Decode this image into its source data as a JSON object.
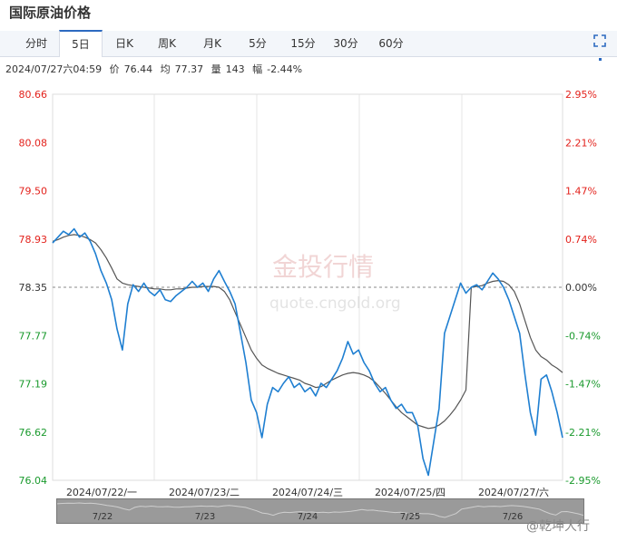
{
  "title": "国际原油价格",
  "tabs": [
    "分时",
    "5日",
    "日K",
    "周K",
    "月K",
    "5分",
    "15分",
    "30分",
    "60分"
  ],
  "active_tab": "5日",
  "info": {
    "time": "2024/07/27六04:59",
    "price_label": "价",
    "price": "76.44",
    "avg_label": "均",
    "avg": "77.37",
    "vol_label": "量",
    "vol": "143",
    "chg_label": "幅",
    "chg": "-2.44%"
  },
  "watermark": {
    "brand": "金投行情",
    "url": "quote.cngold.org"
  },
  "footer_mark": "@乾坤大行",
  "navigator_labels": [
    "7/22",
    "7/23",
    "7/24",
    "7/25",
    "7/26"
  ],
  "colors": {
    "price_line": "#1f7fd1",
    "avg_line": "#555555",
    "up": "#e3221c",
    "down": "#1a9a2d",
    "ref": "#888888"
  },
  "chart_data": {
    "type": "line",
    "ref_price": 78.35,
    "ylim": [
      76.04,
      80.66
    ],
    "y_ticks_left": [
      "80.66",
      "80.08",
      "79.50",
      "78.93",
      "78.35",
      "77.77",
      "77.19",
      "76.62",
      "76.04"
    ],
    "y_ticks_right": [
      "2.95%",
      "2.21%",
      "1.47%",
      "0.74%",
      "0.00%",
      "-0.74%",
      "-1.47%",
      "-2.21%",
      "-2.95%"
    ],
    "x_labels": [
      "2024/07/22/一",
      "2024/07/23/二",
      "2024/07/24/三",
      "2024/07/25/四",
      "2024/07/27/六"
    ],
    "series": [
      {
        "values": [
          78.88,
          78.95,
          79.02,
          78.98,
          79.05,
          78.95,
          79.0,
          78.9,
          78.75,
          78.55,
          78.4,
          78.2,
          77.85,
          77.6,
          78.15,
          78.38,
          78.3,
          78.4,
          78.3,
          78.25,
          78.32,
          78.2,
          78.18,
          78.25,
          78.3,
          78.35,
          78.42,
          78.35,
          78.4,
          78.3,
          78.45,
          78.55,
          78.42,
          78.3,
          78.15,
          77.8,
          77.45,
          77.0,
          76.85,
          76.55,
          76.95,
          77.15,
          77.1,
          77.2,
          77.28,
          77.15,
          77.2,
          77.1,
          77.15,
          77.05,
          77.2,
          77.15,
          77.25,
          77.35,
          77.5,
          77.7,
          77.55,
          77.6,
          77.45,
          77.35,
          77.2,
          77.1,
          77.15,
          77.0,
          76.9,
          76.95,
          76.85,
          76.85,
          76.7,
          76.3,
          76.1,
          76.5,
          76.9,
          77.8,
          78.0,
          78.2,
          78.4,
          78.28,
          78.35,
          78.38,
          78.32,
          78.42,
          78.52,
          78.45,
          78.35,
          78.2,
          78.0,
          77.8,
          77.3,
          76.85,
          76.58,
          77.25,
          77.3,
          77.1,
          76.85,
          76.55
        ]
      },
      {
        "values": [
          78.9,
          78.92,
          78.95,
          78.97,
          78.98,
          78.97,
          78.95,
          78.92,
          78.88,
          78.8,
          78.7,
          78.58,
          78.45,
          78.4,
          78.38,
          78.37,
          78.36,
          78.35,
          78.34,
          78.33,
          78.33,
          78.32,
          78.32,
          78.33,
          78.33,
          78.34,
          78.35,
          78.35,
          78.36,
          78.36,
          78.36,
          78.35,
          78.3,
          78.2,
          78.05,
          77.9,
          77.75,
          77.6,
          77.5,
          77.42,
          77.38,
          77.35,
          77.32,
          77.3,
          77.28,
          77.26,
          77.24,
          77.2,
          77.18,
          77.15,
          77.16,
          77.2,
          77.24,
          77.27,
          77.3,
          77.32,
          77.33,
          77.32,
          77.3,
          77.27,
          77.22,
          77.15,
          77.08,
          77.0,
          76.92,
          76.85,
          76.8,
          76.75,
          76.7,
          76.68,
          76.66,
          76.67,
          76.7,
          76.75,
          76.82,
          76.9,
          77.0,
          77.12,
          78.35,
          78.36,
          78.37,
          78.4,
          78.42,
          78.43,
          78.42,
          78.38,
          78.3,
          78.15,
          77.95,
          77.75,
          77.6,
          77.52,
          77.48,
          77.42,
          77.38,
          77.33
        ]
      }
    ]
  }
}
